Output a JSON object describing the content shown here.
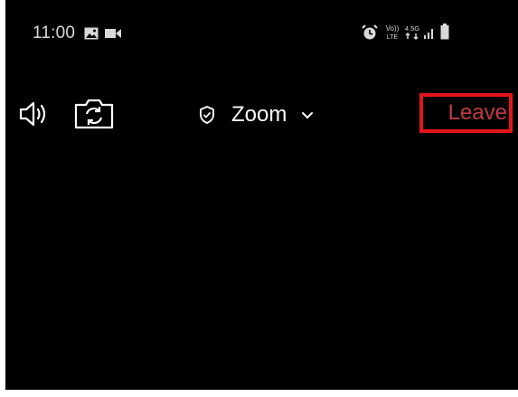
{
  "status_bar": {
    "time": "11:00",
    "left_icons": [
      "gallery-icon",
      "video-recorder-icon"
    ],
    "right_icons": [
      "alarm-icon",
      "volte-lte-icon",
      "4g-data-icon",
      "signal-icon",
      "battery-icon"
    ],
    "volte_text": "Vo))",
    "lte_text": "LTE",
    "data_text": "4.5G"
  },
  "meeting_bar": {
    "speaker_icon": "speaker-icon",
    "camera_icon": "switch-camera-icon",
    "shield_icon": "shield-check-icon",
    "title": "Zoom",
    "chevron_icon": "chevron-down-icon",
    "leave_label": "Leave"
  },
  "colors": {
    "background": "#000000",
    "leave_text": "#c13a42",
    "highlight_box": "#e3161c"
  }
}
